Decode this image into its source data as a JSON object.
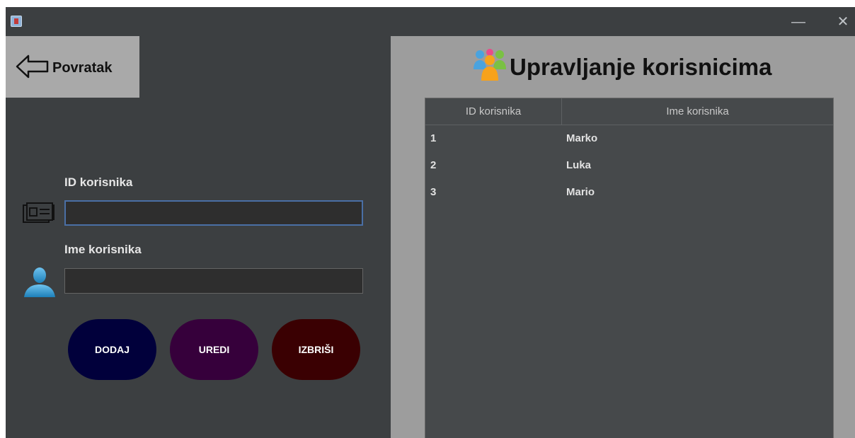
{
  "window": {
    "title": "",
    "controls": {
      "minimize": "—",
      "close": "✕"
    }
  },
  "left": {
    "back_button": {
      "label": "Povratak",
      "icon": "arrow-left-icon"
    },
    "id_field": {
      "label": "ID korisnika",
      "value": "",
      "icon": "id-card-icon"
    },
    "name_field": {
      "label": "Ime korisnika",
      "value": "",
      "icon": "user-icon"
    },
    "buttons": [
      {
        "label": "DODAJ",
        "color": "#01003b"
      },
      {
        "label": "UREDI",
        "color": "#36003b"
      },
      {
        "label": "IZBRIŠI",
        "color": "#3a0002"
      }
    ]
  },
  "right": {
    "title": "Upravljanje korisnicima",
    "title_icon": "users-group-icon",
    "table": {
      "columns": [
        "ID korisnika",
        "Ime korisnika"
      ],
      "rows": [
        [
          "1",
          "Marko"
        ],
        [
          "2",
          "Luka"
        ],
        [
          "3",
          "Mario"
        ]
      ]
    }
  },
  "colors": {
    "window_bg": "#3c3f41",
    "panel_bg": "#9d9d9d",
    "table_bg": "#46494b",
    "focus_border": "#4a6fa5"
  }
}
